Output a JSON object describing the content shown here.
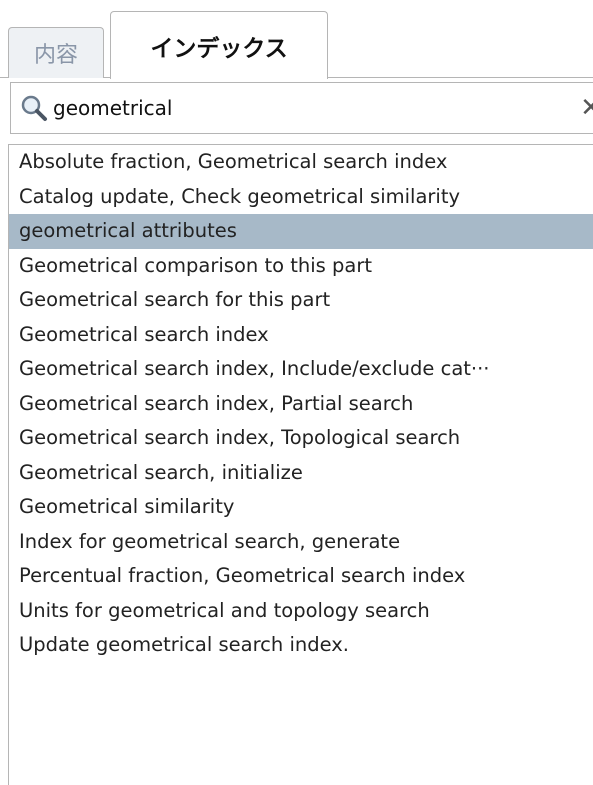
{
  "tabs": [
    {
      "label": "内容",
      "active": false
    },
    {
      "label": "インデックス",
      "active": true
    }
  ],
  "search": {
    "value": "geometrical",
    "icon": "search-icon",
    "clear_icon": "close-icon"
  },
  "index_list": {
    "selected_index": 2,
    "items": [
      "Absolute fraction, Geometrical search index",
      "Catalog update, Check geometrical similarity",
      "geometrical attributes",
      "Geometrical comparison to this part",
      "Geometrical search for this part",
      "Geometrical search index",
      "Geometrical search index, Include/exclude cat···",
      "Geometrical search index, Partial search",
      "Geometrical search index, Topological search",
      "Geometrical search, initialize",
      "Geometrical similarity",
      "Index for geometrical search, generate",
      "Percentual fraction, Geometrical search index",
      "Units for geometrical and topology search",
      "Update geometrical search index."
    ]
  },
  "colors": {
    "selected_row": "#a7b9c8",
    "border": "#b5b5b5",
    "inactive_tab_bg": "#eef1f4",
    "inactive_tab_text": "#8a96a8"
  }
}
